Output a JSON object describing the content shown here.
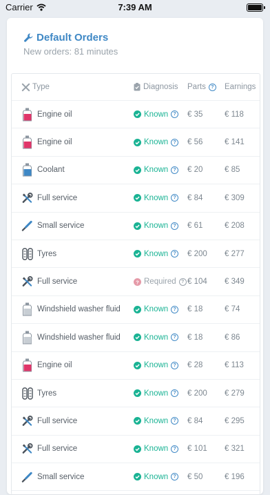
{
  "status_bar": {
    "carrier": "Carrier",
    "time": "7:39 AM"
  },
  "header": {
    "title": "Default Orders",
    "subtitle": "New orders: 81 minutes"
  },
  "table": {
    "columns": {
      "type": "Type",
      "diagnosis": "Diagnosis",
      "parts": "Parts",
      "earnings": "Earnings"
    },
    "rows": [
      {
        "icon": "oil-bottle-icon",
        "type": "Engine oil",
        "diagnosis": "Known",
        "status": "known",
        "parts": "€ 35",
        "earnings": "€ 118"
      },
      {
        "icon": "oil-bottle-icon",
        "type": "Engine oil",
        "diagnosis": "Known",
        "status": "known",
        "parts": "€ 56",
        "earnings": "€ 141"
      },
      {
        "icon": "coolant-bottle-icon",
        "type": "Coolant",
        "diagnosis": "Known",
        "status": "known",
        "parts": "€ 20",
        "earnings": "€ 85"
      },
      {
        "icon": "wrench-screwdriver-icon",
        "type": "Full service",
        "diagnosis": "Known",
        "status": "known",
        "parts": "€ 84",
        "earnings": "€ 309"
      },
      {
        "icon": "screwdriver-icon",
        "type": "Small service",
        "diagnosis": "Known",
        "status": "known",
        "parts": "€ 61",
        "earnings": "€ 208"
      },
      {
        "icon": "tyres-icon",
        "type": "Tyres",
        "diagnosis": "Known",
        "status": "known",
        "parts": "€ 200",
        "earnings": "€ 277"
      },
      {
        "icon": "wrench-screwdriver-icon",
        "type": "Full service",
        "diagnosis": "Required",
        "status": "required",
        "parts": "€ 104",
        "earnings": "€ 349"
      },
      {
        "icon": "washer-fluid-bottle-icon",
        "type": "Windshield washer fluid",
        "diagnosis": "Known",
        "status": "known",
        "parts": "€ 18",
        "earnings": "€ 74"
      },
      {
        "icon": "washer-fluid-bottle-icon",
        "type": "Windshield washer fluid",
        "diagnosis": "Known",
        "status": "known",
        "parts": "€ 18",
        "earnings": "€ 86"
      },
      {
        "icon": "oil-bottle-icon",
        "type": "Engine oil",
        "diagnosis": "Known",
        "status": "known",
        "parts": "€ 28",
        "earnings": "€ 113"
      },
      {
        "icon": "tyres-icon",
        "type": "Tyres",
        "diagnosis": "Known",
        "status": "known",
        "parts": "€ 200",
        "earnings": "€ 279"
      },
      {
        "icon": "wrench-screwdriver-icon",
        "type": "Full service",
        "diagnosis": "Known",
        "status": "known",
        "parts": "€ 84",
        "earnings": "€ 295"
      },
      {
        "icon": "wrench-screwdriver-icon",
        "type": "Full service",
        "diagnosis": "Known",
        "status": "known",
        "parts": "€ 101",
        "earnings": "€ 321"
      },
      {
        "icon": "screwdriver-icon",
        "type": "Small service",
        "diagnosis": "Known",
        "status": "known",
        "parts": "€ 50",
        "earnings": "€ 196"
      }
    ]
  },
  "colors": {
    "accent": "#3f88c5",
    "known": "#1ab394",
    "required": "#e59aa8",
    "oil": "#e0366a",
    "coolant": "#3f88c5",
    "washer": "#8c96a0"
  }
}
